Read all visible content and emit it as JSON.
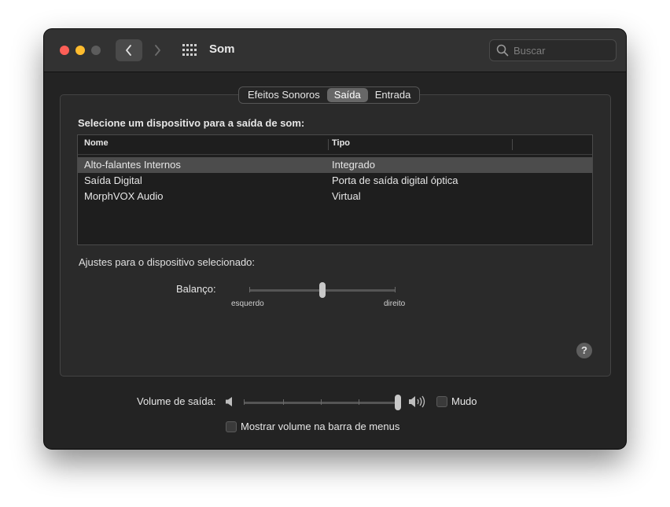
{
  "window": {
    "title": "Som",
    "search_placeholder": "Buscar"
  },
  "tabs": [
    {
      "label": "Efeitos Sonoros",
      "active": false
    },
    {
      "label": "Saída",
      "active": true
    },
    {
      "label": "Entrada",
      "active": false
    }
  ],
  "output": {
    "heading": "Selecione um dispositivo para a saída de som:",
    "columns": [
      "Nome",
      "Tipo"
    ],
    "devices": [
      {
        "name": "Alto-falantes Internos",
        "type": "Integrado",
        "selected": true
      },
      {
        "name": "Saída Digital",
        "type": "Porta de saída digital óptica",
        "selected": false
      },
      {
        "name": "MorphVOX Audio",
        "type": "Virtual",
        "selected": false
      }
    ]
  },
  "settings": {
    "heading": "Ajustes para o dispositivo selecionado:",
    "balance_label": "Balanço:",
    "balance_left": "esquerdo",
    "balance_right": "direito",
    "balance_value": 0.5,
    "help": "?"
  },
  "volume": {
    "label": "Volume de saída:",
    "value": 1.0,
    "mute_label": "Mudo",
    "mute_checked": false,
    "menubar_label": "Mostrar volume na barra de menus",
    "menubar_checked": false
  }
}
